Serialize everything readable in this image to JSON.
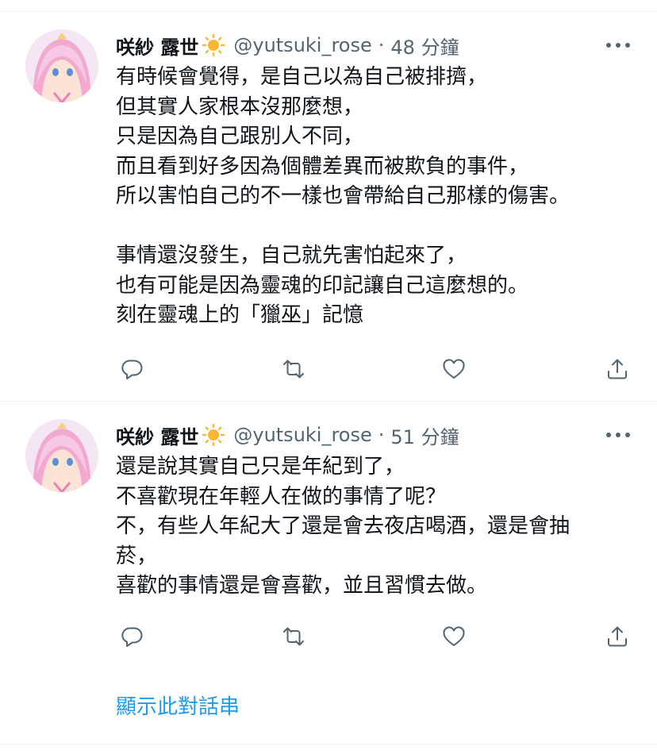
{
  "tweets": [
    {
      "author": {
        "display_name": "咲紗 露世",
        "emoji_icon": "sun-icon",
        "handle": "@yutsuki_rose"
      },
      "separator": "·",
      "time": "48 分鐘",
      "lines": [
        "有時候會覺得，是自己以為自己被排擠，",
        "但其實人家根本沒那麼想，",
        "只是因為自己跟別人不同，",
        "而且看到好多因為個體差異而被欺負的事件，",
        "所以害怕自己的不一樣也會帶給自己那樣的傷害。",
        "",
        "事情還沒發生，自己就先害怕起來了，",
        "也有可能是因為靈魂的印記讓自己這麼想的。",
        "刻在靈魂上的「獵巫」記憶"
      ]
    },
    {
      "author": {
        "display_name": "咲紗 露世",
        "emoji_icon": "sun-icon",
        "handle": "@yutsuki_rose"
      },
      "separator": "·",
      "time": "51 分鐘",
      "lines": [
        "還是說其實自己只是年紀到了，",
        "不喜歡現在年輕人在做的事情了呢？",
        "不，有些人年紀大了還是會去夜店喝酒，還是會抽",
        "菸，",
        "喜歡的事情還是會喜歡，並且習慣去做。"
      ]
    }
  ],
  "show_thread_label": "顯示此對話串",
  "colors": {
    "accent": "#1d9bf0",
    "text": "#0f1419",
    "secondary": "#536471",
    "divider": "#eff3f4"
  },
  "icons": [
    "more-icon",
    "reply-icon",
    "retweet-icon",
    "like-icon",
    "share-icon"
  ]
}
